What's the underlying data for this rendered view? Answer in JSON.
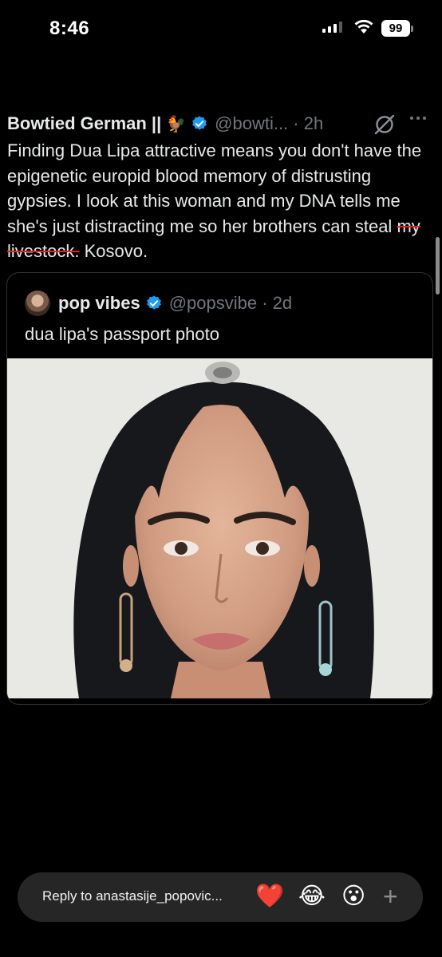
{
  "status_bar": {
    "time": "8:46",
    "battery": "99"
  },
  "tweet": {
    "author": "Bowtied German ||",
    "author_emoji": "🐓",
    "handle_time": "@bowti... · 2h",
    "text_plain": "Finding Dua Lipa attractive means you don't have the epigenetic europid blood memory of distrusting gypsies.  I look at this woman and my DNA tells me she's just distracting me so her brothers can steal ",
    "text_struck": "my livestock.",
    "text_after": " Kosovo."
  },
  "quote": {
    "author": "pop vibes",
    "handle_time": "@popsvibe · 2d",
    "text": "dua lipa's passport photo"
  },
  "reply_bar": {
    "placeholder": "Reply to anastasije_popovic...",
    "reactions": [
      "❤️",
      "😂",
      "😮"
    ],
    "add": "+"
  },
  "colors": {
    "verified": "#1d9bf0",
    "strike": "#e0241d",
    "muted": "#71767b"
  }
}
